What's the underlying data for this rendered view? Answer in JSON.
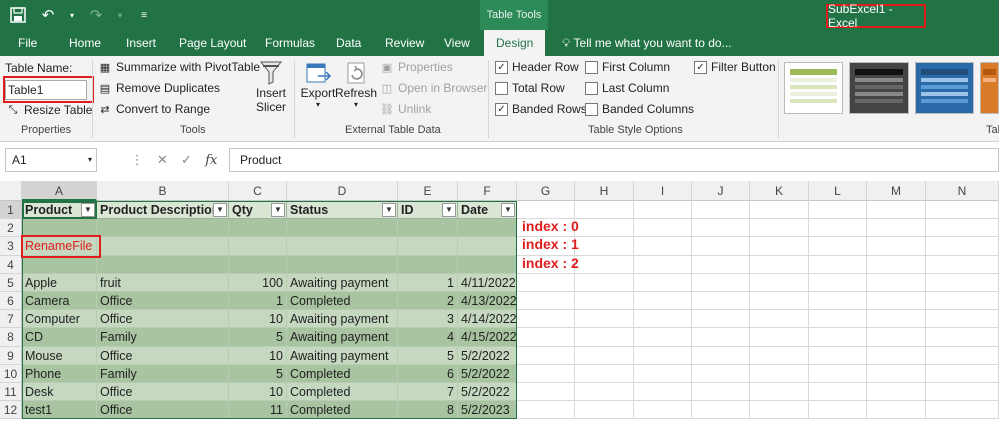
{
  "titlebar": {
    "table_tools": "Table Tools",
    "window_title": "SubExcel1 - Excel"
  },
  "tabs": [
    "File",
    "Home",
    "Insert",
    "Page Layout",
    "Formulas",
    "Data",
    "Review",
    "View",
    "Design"
  ],
  "tell_me": "Tell me what you want to do...",
  "ribbon": {
    "properties": {
      "table_name_label": "Table Name:",
      "table_name_value": "Table1",
      "resize": "Resize Table",
      "group": "Properties"
    },
    "tools": {
      "summarize": "Summarize with PivotTable",
      "remove_duplicates": "Remove Duplicates",
      "convert": "Convert to Range",
      "insert_slicer": "Insert Slicer",
      "insert_slicer_l1": "Insert",
      "insert_slicer_l2": "Slicer",
      "group": "Tools"
    },
    "external": {
      "export": "Export",
      "refresh": "Refresh",
      "properties": "Properties",
      "open_in_browser": "Open in Browser",
      "unlink": "Unlink",
      "group": "External Table Data"
    },
    "style_options": {
      "header_row": "Header Row",
      "total_row": "Total Row",
      "banded_rows": "Banded Rows",
      "first_column": "First Column",
      "last_column": "Last Column",
      "banded_columns": "Banded Columns",
      "filter_button": "Filter Button",
      "group": "Table Style Options"
    },
    "table_styles_group": "Tab"
  },
  "formula_bar": {
    "name_box": "A1",
    "formula": "Product"
  },
  "columns": [
    "A",
    "B",
    "C",
    "D",
    "E",
    "F",
    "G",
    "H",
    "I",
    "J",
    "K",
    "L",
    "M",
    "N"
  ],
  "rows": [
    "1",
    "2",
    "3",
    "4",
    "5",
    "6",
    "7",
    "8",
    "9",
    "10",
    "11",
    "12"
  ],
  "table": {
    "headers": [
      "Product",
      "Product Description",
      "Qty",
      "Status",
      "ID",
      "Date"
    ],
    "row3_a": "RenameFile",
    "data": [
      [
        "Apple",
        "fruit",
        "100",
        "Awaiting payment",
        "1",
        "4/11/2022"
      ],
      [
        "Camera",
        "Office",
        "1",
        "Completed",
        "2",
        "4/13/2022"
      ],
      [
        "Computer",
        "Office",
        "10",
        "Awaiting payment",
        "3",
        "4/14/2022"
      ],
      [
        "CD",
        "Family",
        "5",
        "Awaiting payment",
        "4",
        "4/15/2022"
      ],
      [
        "Mouse",
        "Office",
        "10",
        "Awaiting payment",
        "5",
        "5/2/2022"
      ],
      [
        "Phone",
        "Family",
        "5",
        "Completed",
        "6",
        "5/2/2022"
      ],
      [
        "Desk",
        "Office",
        "10",
        "Completed",
        "7",
        "5/2/2022"
      ],
      [
        "test1",
        "Office",
        "11",
        "Completed",
        "8",
        "5/2/2023"
      ]
    ]
  },
  "annotations": [
    "index : 0",
    "index : 1",
    "index : 2"
  ],
  "colors": {
    "excel_green": "#217346",
    "band_dark": "#a9c4a0",
    "band_light": "#c6d9c0",
    "header_fill": "#d9e6d4",
    "annotation_red": "#e01d1d"
  }
}
